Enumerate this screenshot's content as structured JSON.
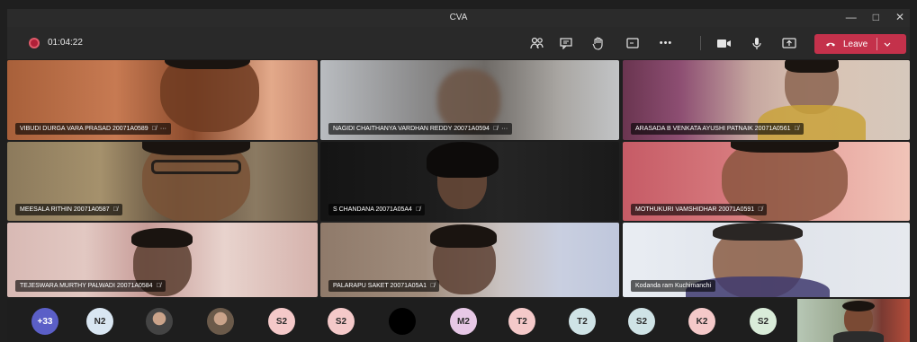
{
  "window": {
    "title": "CVA",
    "minimize": "—",
    "maximize": "□",
    "close": "✕"
  },
  "toolbar": {
    "recording_time": "01:04:22",
    "leave_label": "Leave",
    "icons": [
      "participants-icon",
      "chat-icon",
      "raise-hand-icon",
      "share-tray-icon",
      "more-actions-icon",
      "camera-icon",
      "microphone-icon",
      "share-screen-icon"
    ]
  },
  "participants": [
    {
      "name": "VIBUDI DURGA VARA PRASAD 20071A0589",
      "muted": true,
      "more": "···"
    },
    {
      "name": "NAGIDI CHAITHANYA VARDHAN REDDY 20071A0594",
      "muted": true,
      "more": "···"
    },
    {
      "name": "ARASADA B VENKATA AYUSHI PATNAIK 20071A0561",
      "muted": true
    },
    {
      "name": "MEESALA RITHIN 20071A0587",
      "muted": true
    },
    {
      "name": "S CHANDANA 20071A05A4",
      "muted": true
    },
    {
      "name": "MOTHUKURI VAMSHIDHAR 20071A0591",
      "muted": true
    },
    {
      "name": "TEJESWARA MURTHY PALWADI 20071A0584",
      "muted": true
    },
    {
      "name": "PALARAPU SAKET 20071A05A1",
      "muted": true
    },
    {
      "name": "Kodanda ram Kuchimanchi",
      "muted": false
    }
  ],
  "bottom_avatars": [
    {
      "text": "+33",
      "color": "#5b5fc7",
      "text_color": "#ffffff"
    },
    {
      "text": "N2",
      "color": "#d9e6f2"
    },
    {
      "text": "",
      "color": "#444444",
      "photo": true
    },
    {
      "text": "",
      "color": "#6b5a4a",
      "photo": true
    },
    {
      "text": "S2",
      "color": "#f4c9c9"
    },
    {
      "text": "S2",
      "color": "#f4c9c9"
    },
    {
      "text": "",
      "color": "#000000"
    },
    {
      "text": "M2",
      "color": "#e7c8e6"
    },
    {
      "text": "T2",
      "color": "#f4c9c9"
    },
    {
      "text": "T2",
      "color": "#cfe3e6"
    },
    {
      "text": "S2",
      "color": "#cfe3e6"
    },
    {
      "text": "K2",
      "color": "#f4c9c9"
    },
    {
      "text": "S2",
      "color": "#d9ecd9"
    }
  ]
}
